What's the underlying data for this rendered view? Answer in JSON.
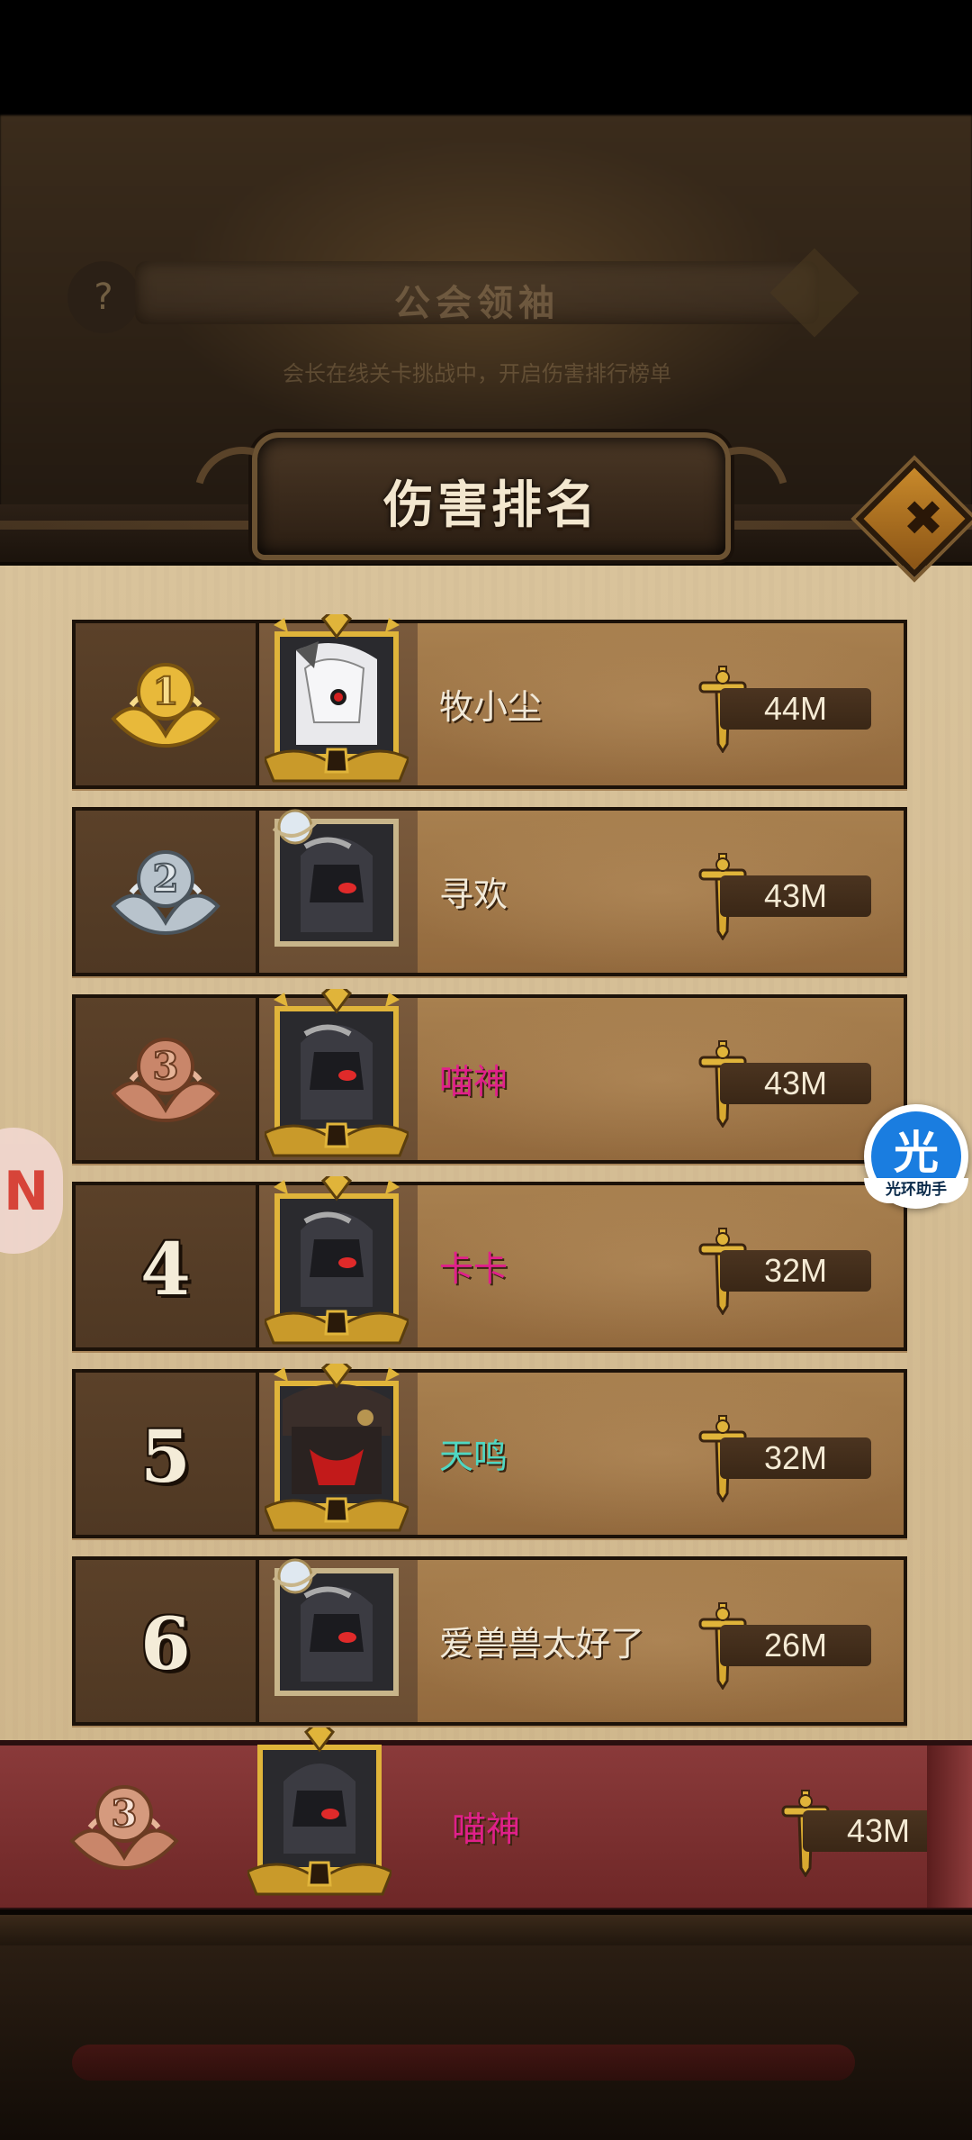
{
  "background": {
    "blurred_title": "公会领袖",
    "blurred_subtitle": "会长在线关卡挑战中，开启伤害排行榜单",
    "help_icon": "?"
  },
  "panel": {
    "title": "伤害排名",
    "close_icon": "✖"
  },
  "rankings": [
    {
      "rank": "1",
      "medal": "gold",
      "name": "牧小尘",
      "name_color": "#f1e9d8",
      "damage": "44M",
      "frame": "gold",
      "avatar": "white-masked-hero"
    },
    {
      "rank": "2",
      "medal": "silver",
      "name": "寻欢",
      "name_color": "#f1e9d8",
      "damage": "43M",
      "frame": "moon-silver",
      "avatar": "dark-armored-hero"
    },
    {
      "rank": "3",
      "medal": "bronze",
      "name": "喵神",
      "name_color": "#e0208a",
      "damage": "43M",
      "frame": "gold",
      "avatar": "dark-armored-hero"
    },
    {
      "rank": "4",
      "medal": "none",
      "name": "卡卡",
      "name_color": "#e0208a",
      "damage": "32M",
      "frame": "gold",
      "avatar": "dark-armored-hero"
    },
    {
      "rank": "5",
      "medal": "none",
      "name": "天鸣",
      "name_color": "#4fd7c2",
      "damage": "32M",
      "frame": "gold",
      "avatar": "hooded-red-hero"
    },
    {
      "rank": "6",
      "medal": "none",
      "name": "爱兽兽太好了",
      "name_color": "#f1e9d8",
      "damage": "26M",
      "frame": "moon-silver",
      "avatar": "dark-armored-hero"
    }
  ],
  "my_rank": {
    "rank": "3",
    "medal": "bronze",
    "name": "喵神",
    "name_color": "#e0208a",
    "damage": "43M"
  },
  "floating_helper": {
    "glyph": "光",
    "label": "光环助手"
  },
  "colors": {
    "gold": "#e8b93a",
    "silver": "#b8c3cc",
    "bronze": "#c9866a",
    "accent_pink": "#e0208a",
    "accent_teal": "#4fd7c2"
  }
}
